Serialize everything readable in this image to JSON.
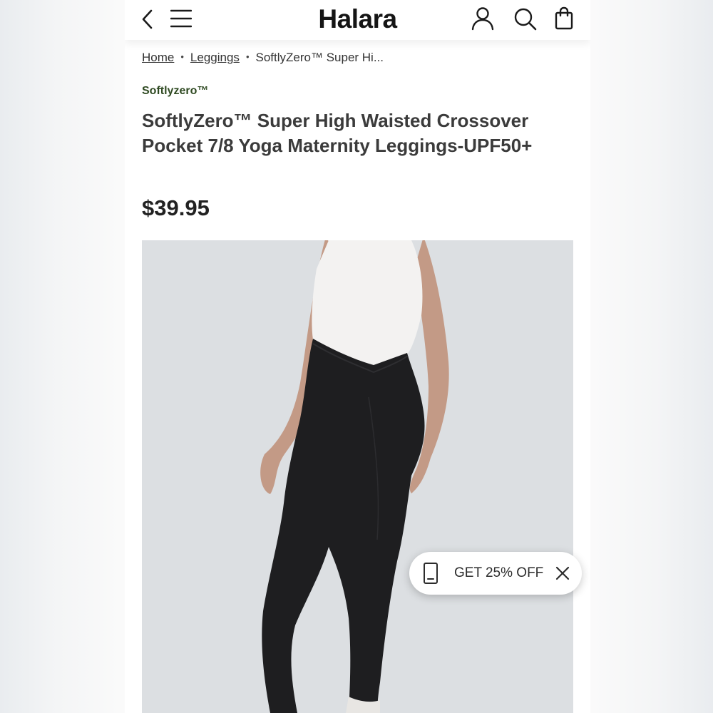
{
  "header": {
    "logo": "Halara",
    "icons": [
      "back-arrow-icon",
      "menu-icon",
      "account-icon",
      "search-icon",
      "shopping-bag-icon"
    ]
  },
  "breadcrumb": {
    "items": [
      "Home",
      "Leggings",
      "SoftlyZero™ Super Hi..."
    ]
  },
  "product": {
    "brand": "Softlyzero™",
    "title": "SoftlyZero™ Super High Waisted Crossover Pocket 7/8 Yoga Maternity Leggings-UPF50+",
    "price": "$39.95"
  },
  "promo": {
    "label": "GET 25% OFF",
    "icons": [
      "phone-icon",
      "close-icon"
    ]
  },
  "colors": {
    "brand_green": "#2f4a22",
    "text_dark": "#222222",
    "image_background": "#dcdfe2"
  }
}
